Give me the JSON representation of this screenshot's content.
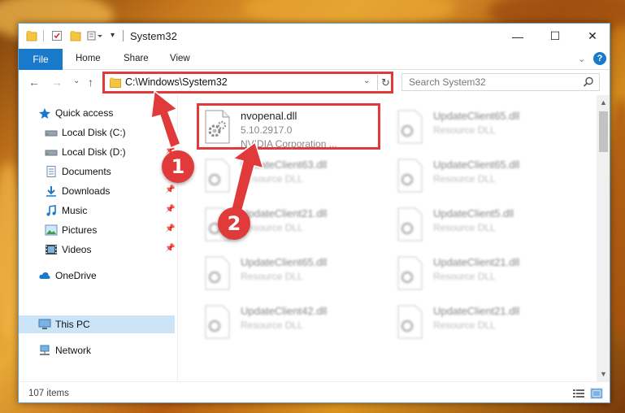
{
  "window": {
    "title": "System32",
    "controls": {
      "minimize": "—",
      "maximize": "☐",
      "close": "✕"
    }
  },
  "ribbon": {
    "tabs": [
      "File",
      "Home",
      "Share",
      "View"
    ],
    "help": "?"
  },
  "address": {
    "path": "C:\\Windows\\System32",
    "search_placeholder": "Search System32"
  },
  "nav": {
    "items": [
      {
        "label": "Quick access",
        "icon": "star-icon"
      },
      {
        "label": "Local Disk (C:)",
        "icon": "drive-icon",
        "pinned": true
      },
      {
        "label": "Local Disk (D:)",
        "icon": "drive-icon",
        "pinned": true
      },
      {
        "label": "Documents",
        "icon": "documents-icon",
        "pinned": true
      },
      {
        "label": "Downloads",
        "icon": "download-icon",
        "pinned": true
      },
      {
        "label": "Music",
        "icon": "music-icon",
        "pinned": true
      },
      {
        "label": "Pictures",
        "icon": "pictures-icon",
        "pinned": true
      },
      {
        "label": "Videos",
        "icon": "videos-icon",
        "pinned": true
      },
      {
        "label": "OneDrive",
        "icon": "cloud-icon"
      },
      {
        "label": "This PC",
        "icon": "computer-icon",
        "selected": true
      },
      {
        "label": "Network",
        "icon": "network-icon"
      }
    ]
  },
  "files": {
    "highlighted": {
      "name": "nvopenal.dll",
      "version": "5.10.2917.0",
      "company": "NVIDIA Corporation ..."
    },
    "blurred": [
      {
        "name": "UpdateClient65.dll",
        "type": "Resource DLL"
      },
      {
        "name": "UpdateClient63.dll",
        "type": "Resource DLL"
      },
      {
        "name": "UpdateClient65.dll",
        "type": "Resource DLL"
      },
      {
        "name": "UpdateClient21.dll",
        "type": "Resource DLL"
      },
      {
        "name": "UpdateClient5.dll",
        "type": "Resource DLL"
      },
      {
        "name": "UpdateClient65.dll",
        "type": "Resource DLL"
      },
      {
        "name": "UpdateClient21.dll",
        "type": "Resource DLL"
      },
      {
        "name": "UpdateClient42.dll",
        "type": "Resource DLL"
      },
      {
        "name": "UpdateClient21.dll",
        "type": "Resource DLL"
      }
    ]
  },
  "status": {
    "item_count": "107 items"
  },
  "annotations": {
    "marker1": "1",
    "marker2": "2"
  },
  "colors": {
    "accent": "#1979ca",
    "annotation": "#e03a3a",
    "selection": "#cce4f7"
  }
}
